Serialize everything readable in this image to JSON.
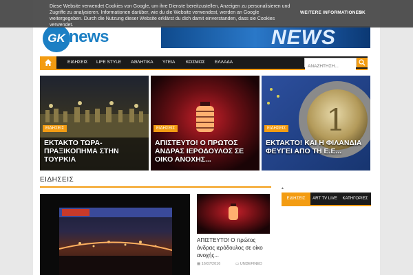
{
  "cookie": {
    "text": "Diese Website verwendet Cookies von Google, um ihre Dienste bereitzustellen, Anzeigen zu personalisieren und Zugriffe zu analysieren. Informationen darüber, wie du die Website verwendest, werden an Google weitergegeben. Durch die Nutzung dieser Website erklärst du dich damit einverstanden, dass sie Cookies verwendet.",
    "more_label": "WEITERE INFORMATIONEN",
    "ok_label": "OK"
  },
  "header": {
    "logo_gk": "GK",
    "logo_news": "news",
    "banner_text": "NEWS"
  },
  "nav": {
    "items": [
      "ΕΙΔΗΣΕΙΣ",
      "LIFE STYLE",
      "ΑΘΛΗΤΙΚΑ",
      "ΥΓΕΙΑ",
      "ΚΟΣΜΟΣ",
      "ΕΛΛΑΔΑ"
    ],
    "search_placeholder": "ΑΝΑΖΗΤΗΣΗ..."
  },
  "slides": [
    {
      "category": "ΕΙΔΗΣΕΙΣ",
      "title": "ΕΚΤΑΚΤΟ ΤΩΡΑ- ΠΡΑΞΙΚΟΠΗΜΑ ΣΤΗΝ ΤΟΥΡΚΙΑ"
    },
    {
      "category": "ΕΙΔΗΣΕΙΣ",
      "title": "ΑΠΙΣΤΕΥΤΟ! Ο ΠΡΩΤΟΣ ΑΝΔΡΑΣ ΙΕΡΟΔΟΥΛΟΣ ΣΕ ΟΙΚΟ ΑΝΟΧΗΣ..."
    },
    {
      "category": "ΕΙΔΗΣΕΙΣ",
      "title": "ΕΚΤΑΚΤΟ! ΚΑΙ Η ΦΙΛΑΝΔΙΑ ΦΕΥΓΕΙ ΑΠΟ ΤΗ Ε.Ε..."
    }
  ],
  "section": {
    "title": "ΕΙΔΗΣΕΙΣ",
    "post": {
      "title": "ΑΠΙΣΤΕΥΤΟ! Ο πρώτος άνδρας ιερόδουλος σε οίκο ανοχής...",
      "date": "16/07/2016",
      "category": "UNDEFINED"
    }
  },
  "tabs": [
    {
      "label": "ΕΙΔΗΣΕΙΣ",
      "active": true
    },
    {
      "label": "ART TV LIVE",
      "active": false
    },
    {
      "label": "ΚΑΤΗΓΟΡΙΕΣ",
      "active": false
    }
  ],
  "colors": {
    "accent": "#f39c12",
    "nav_bg": "#1b1b1b",
    "logo_blue": "#1c7fc4"
  }
}
